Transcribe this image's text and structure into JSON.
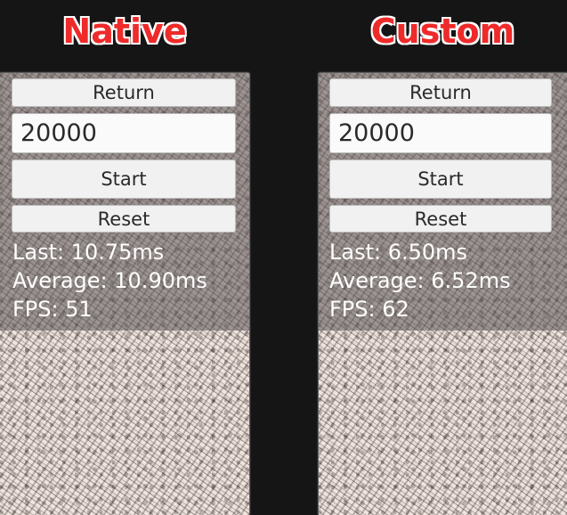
{
  "headings": {
    "native": "Native",
    "custom": "Custom"
  },
  "panels": {
    "native": {
      "return_label": "Return",
      "count_value": "20000",
      "start_label": "Start",
      "reset_label": "Reset",
      "last": "Last: 10.75ms",
      "average": "Average: 10.90ms",
      "fps": "FPS: 51"
    },
    "custom": {
      "return_label": "Return",
      "count_value": "20000",
      "start_label": "Start",
      "reset_label": "Reset",
      "last": "Last: 6.50ms",
      "average": "Average: 6.52ms",
      "fps": "FPS: 62"
    }
  },
  "colors": {
    "heading": "#ef2a2a",
    "background": "#151515"
  }
}
